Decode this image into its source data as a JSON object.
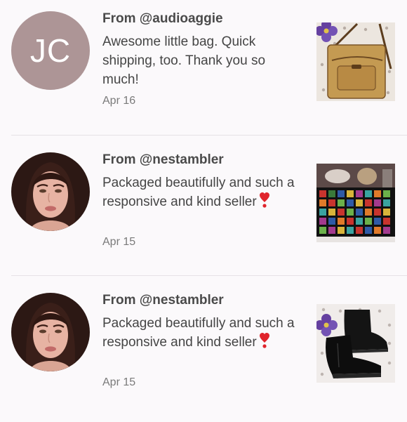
{
  "reviews": [
    {
      "avatar_initials": "JC",
      "from": "From @audioaggie",
      "text": "Awesome little bag. Quick shipping, too. Thank you so much!",
      "date": "Apr 16",
      "avatar_type": "initials",
      "avatar_color": "#ad9596",
      "item_icon": "purse-photo"
    },
    {
      "from": "From @nestambler",
      "text": "Packaged beautifully and such a responsive and kind seller",
      "date": "Apr 15",
      "avatar_type": "photo",
      "item_icon": "blanket-photo"
    },
    {
      "from": "From @nestambler",
      "text": "Packaged beautifully and such a responsive and kind seller",
      "date": "Apr 15",
      "avatar_type": "photo",
      "item_icon": "boots-photo"
    }
  ],
  "colors": {
    "background": "#fbf9fb",
    "divider": "#e6e2e6",
    "heart": "#e0242c"
  }
}
